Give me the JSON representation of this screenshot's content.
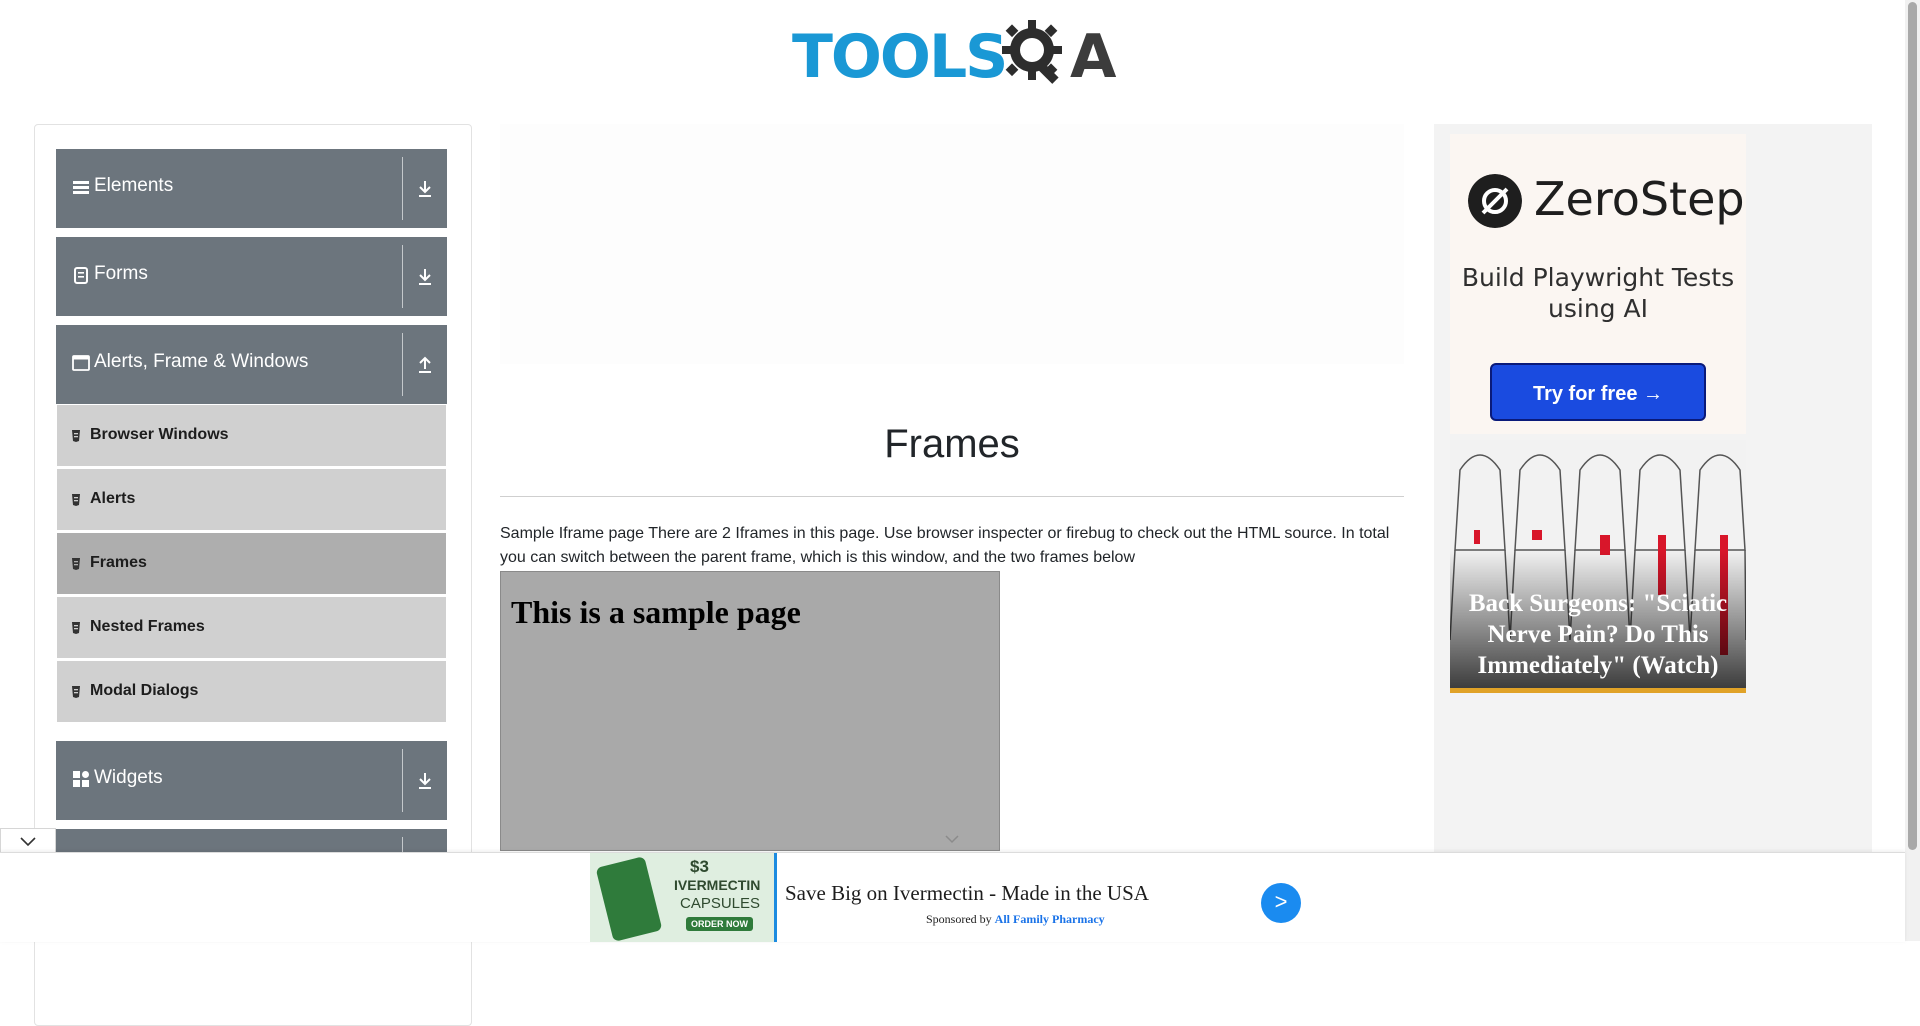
{
  "header": {
    "logo_primary": "TOOLS",
    "logo_secondary": "A",
    "logo_mark": "QA gear"
  },
  "sidebar": {
    "groups": [
      {
        "label": "Elements",
        "icon": "hamburger-icon",
        "expand_icon": "download-arrow-icon"
      },
      {
        "label": "Forms",
        "icon": "document-icon",
        "expand_icon": "download-arrow-icon"
      },
      {
        "label": "Alerts, Frame & Windows",
        "icon": "window-icon",
        "expand_icon": "upload-arrow-icon"
      },
      {
        "label": "Widgets",
        "icon": "grid-icon",
        "expand_icon": "download-arrow-icon"
      }
    ],
    "sub_items": [
      {
        "label": "Browser Windows",
        "active": false
      },
      {
        "label": "Alerts",
        "active": false
      },
      {
        "label": "Frames",
        "active": true
      },
      {
        "label": "Nested Frames",
        "active": false
      },
      {
        "label": "Modal Dialogs",
        "active": false
      }
    ]
  },
  "main": {
    "title": "Frames",
    "intro": "Sample Iframe page There are 2 Iframes in this page. Use browser inspecter or firebug to check out the HTML source. In total you can switch between the parent frame, which is this window, and the two frames below",
    "frame1_heading": "This is a sample page"
  },
  "right_ad": {
    "brand": "ZeroStep",
    "tagline": "Build Playwright Tests using AI",
    "cta": "Try for free →",
    "story_text": "Back Surgeons: \"Sciatic Nerve Pain? Do This Immediately\" (Watch)"
  },
  "bottom_ad": {
    "product_price": "$3",
    "product_name": "IVERMECTIN",
    "product_sub": "CAPSULES",
    "product_order": "ORDER NOW",
    "headline": "Save Big on Ivermectin - Made in the USA",
    "sponsored_by": "Sponsored by",
    "sponsor_name": "All Family Pharmacy",
    "go_label": ">"
  },
  "colors": {
    "group_bg": "#6c757d",
    "sub_bg": "#d0d0d0",
    "sub_active_bg": "#aeaeae",
    "logo_blue": "#1a98d5",
    "cta_blue": "#1a4be0"
  }
}
